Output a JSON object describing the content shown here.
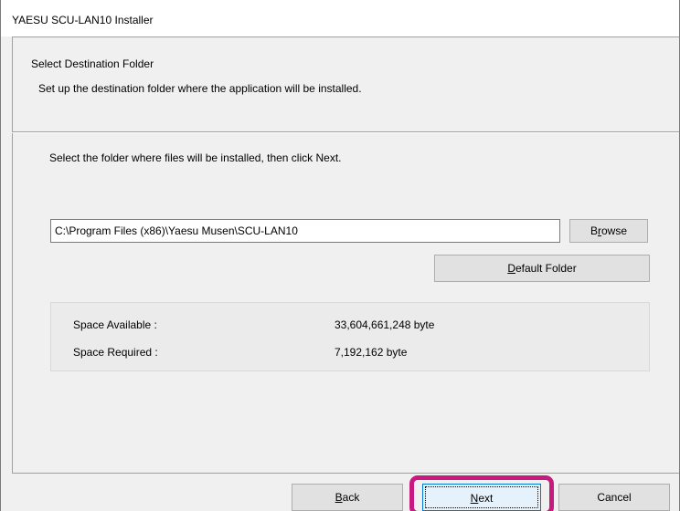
{
  "window": {
    "title": "YAESU SCU-LAN10 Installer"
  },
  "header": {
    "title": "Select Destination Folder",
    "subtitle": "Set up the destination folder where the application will be installed."
  },
  "main": {
    "instruction": "Select the folder where files will be installed, then click Next.",
    "path_value": "C:\\Program Files (x86)\\Yaesu Musen\\SCU-LAN10",
    "browse": {
      "pre": "B",
      "ul": "r",
      "post": "owse"
    },
    "default_folder": {
      "pre": "",
      "ul": "D",
      "post": "efault Folder"
    },
    "space": {
      "available_label": "Space Available :",
      "available_value": "33,604,661,248 byte",
      "required_label": "Space Required :",
      "required_value": "7,192,162 byte"
    }
  },
  "footer": {
    "back": {
      "ul": "B",
      "post": "ack"
    },
    "next": {
      "ul": "N",
      "post": "ext"
    },
    "cancel_label": "Cancel",
    "highlight_color": "#c8197e"
  }
}
